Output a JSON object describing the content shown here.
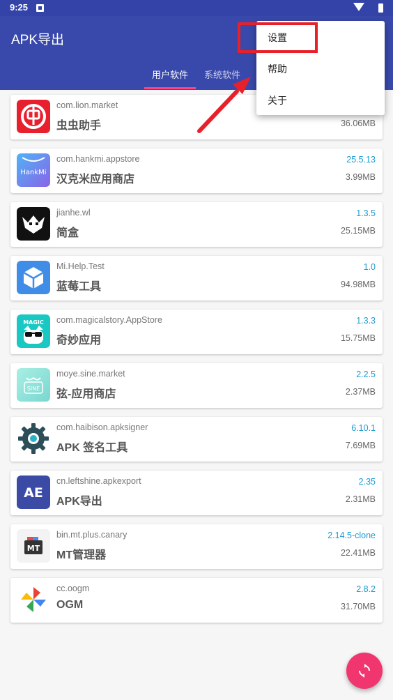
{
  "status_bar": {
    "time": "9:25"
  },
  "app": {
    "title": "APK导出"
  },
  "tabs": [
    {
      "label": "用户软件",
      "active": true
    },
    {
      "label": "系统软件",
      "active": false
    }
  ],
  "menu": {
    "items": [
      {
        "label": "设置"
      },
      {
        "label": "帮助"
      },
      {
        "label": "关于"
      }
    ]
  },
  "apps": [
    {
      "package": "com.lion.market",
      "name": "虫虫助手",
      "version": "",
      "size": "36.06MB",
      "icon": "chongchong-icon"
    },
    {
      "package": "com.hankmi.appstore",
      "name": "汉克米应用商店",
      "version": "25.5.13",
      "size": "3.99MB",
      "icon": "hankmi-icon",
      "icon_text": "HankMi"
    },
    {
      "package": "jianhe.wl",
      "name": "简盒",
      "version": "1.3.5",
      "size": "25.15MB",
      "icon": "jianhe-icon"
    },
    {
      "package": "Mi.Help.Test",
      "name": "蓝莓工具",
      "version": "1.0",
      "size": "94.98MB",
      "icon": "cube-icon"
    },
    {
      "package": "com.magicalstory.AppStore",
      "name": "奇妙应用",
      "version": "1.3.3",
      "size": "15.75MB",
      "icon": "magic-icon",
      "icon_text": "MAGIC"
    },
    {
      "package": "moye.sine.market",
      "name": "弦-应用商店",
      "version": "2.2.5",
      "size": "2.37MB",
      "icon": "sine-icon",
      "icon_text": "SINE"
    },
    {
      "package": "com.haibison.apksigner",
      "name": "APK 签名工具",
      "version": "6.10.1",
      "size": "7.69MB",
      "icon": "gear-icon"
    },
    {
      "package": "cn.leftshine.apkexport",
      "name": "APK导出",
      "version": "2.35",
      "size": "2.31MB",
      "icon": "ae-icon",
      "icon_text": "AE"
    },
    {
      "package": "bin.mt.plus.canary",
      "name": "MT管理器",
      "version": "2.14.5-clone",
      "size": "22.41MB",
      "icon": "mt-icon",
      "icon_text": "MT"
    },
    {
      "package": "cc.oogm",
      "name": "OGM",
      "version": "2.8.2",
      "size": "31.70MB",
      "icon": "pinwheel-icon"
    }
  ],
  "colors": {
    "primary": "#3949ab",
    "accent": "#ff4081",
    "version": "#1d9bd1",
    "fab": "#f1366f",
    "highlight": "#e8202a"
  },
  "fab": {
    "icon": "refresh-icon"
  }
}
